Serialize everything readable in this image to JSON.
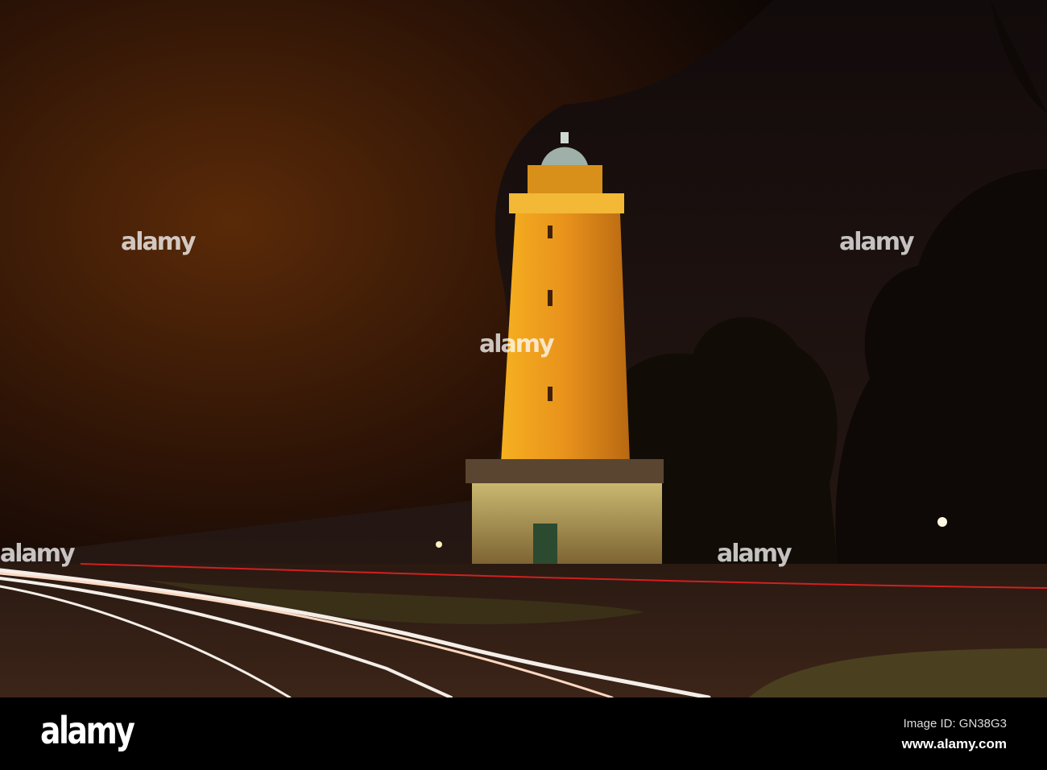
{
  "photo": {
    "subject": "Illuminated water tower at night with light trails"
  },
  "watermark": {
    "text": "alamy"
  },
  "footer": {
    "logo": "alamy",
    "image_id": "Image ID: GN38G3",
    "url": "www.alamy.com"
  },
  "colors": {
    "tower_glow": "#f0a020",
    "sky": "#1a0f0c",
    "bar": "#000000"
  }
}
